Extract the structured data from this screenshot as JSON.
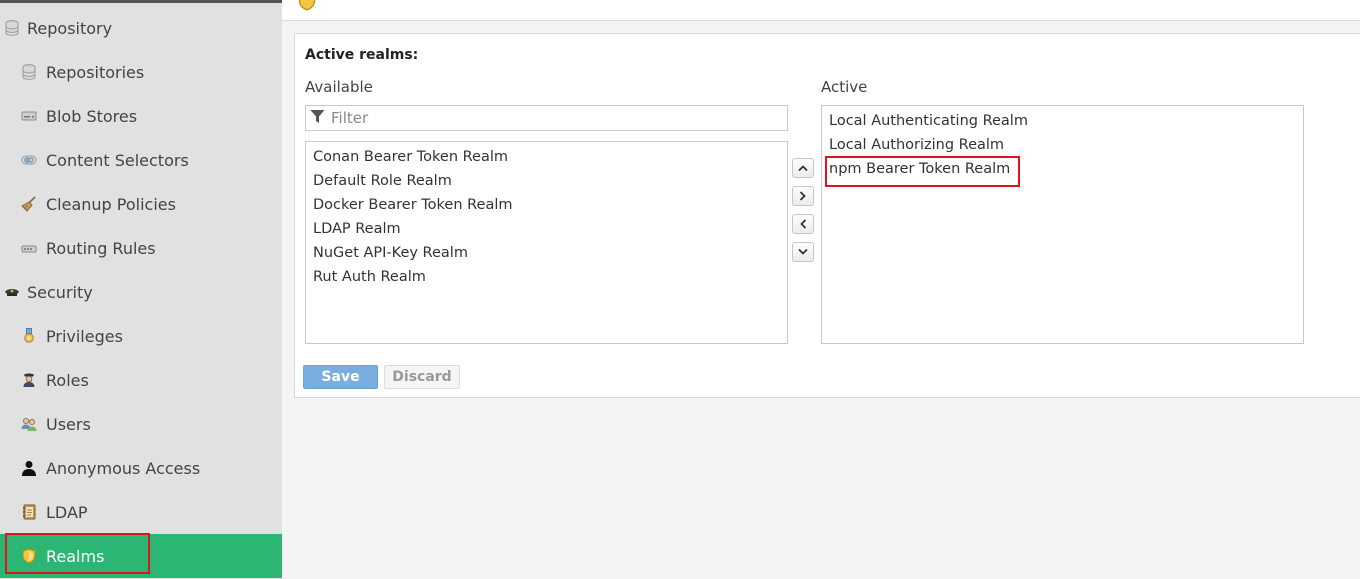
{
  "sidebar": {
    "items": [
      {
        "label": "Repository",
        "icon": "database-icon"
      },
      {
        "label": "Repositories",
        "icon": "database-icon"
      },
      {
        "label": "Blob Stores",
        "icon": "hard-drive-icon"
      },
      {
        "label": "Content Selectors",
        "icon": "content-selector-icon"
      },
      {
        "label": "Cleanup Policies",
        "icon": "broom-icon"
      },
      {
        "label": "Routing Rules",
        "icon": "router-icon"
      },
      {
        "label": "Security",
        "icon": "police-hat-icon"
      },
      {
        "label": "Privileges",
        "icon": "medal-icon"
      },
      {
        "label": "Roles",
        "icon": "officer-icon"
      },
      {
        "label": "Users",
        "icon": "users-icon"
      },
      {
        "label": "Anonymous Access",
        "icon": "user-silhouette-icon"
      },
      {
        "label": "LDAP",
        "icon": "address-book-icon"
      },
      {
        "label": "Realms",
        "icon": "shield-icon"
      }
    ],
    "active": "Realms"
  },
  "realms": {
    "title": "Active realms:",
    "available_label": "Available",
    "active_label": "Active",
    "filter_placeholder": "Filter",
    "available": [
      "Conan Bearer Token Realm",
      "Default Role Realm",
      "Docker Bearer Token Realm",
      "LDAP Realm",
      "NuGet API-Key Realm",
      "Rut Auth Realm"
    ],
    "active": [
      "Local Authenticating Realm",
      "Local Authorizing Realm",
      "npm Bearer Token Realm"
    ]
  },
  "buttons": {
    "save": "Save",
    "discard": "Discard"
  },
  "colors": {
    "active_nav": "#2bb673",
    "save_button": "#7aaee0",
    "highlight": "#e0141e"
  }
}
